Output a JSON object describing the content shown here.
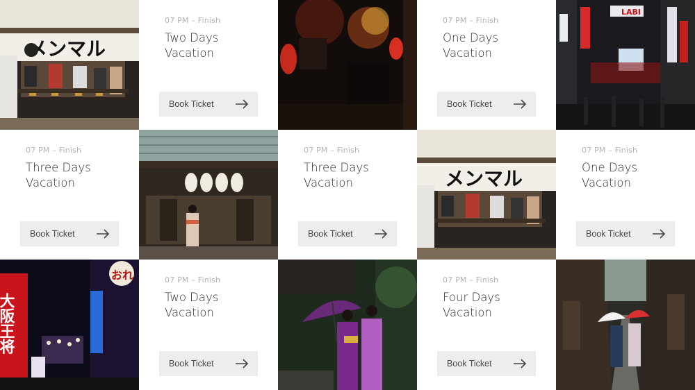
{
  "cards": [
    {
      "time": "07 PM – Finish",
      "title_line1": "Two Days",
      "title_line2": "Vacation",
      "button": "Book Ticket"
    },
    {
      "time": "07 PM – Finish",
      "title_line1": "One Days",
      "title_line2": "Vacation",
      "button": "Book Ticket"
    },
    {
      "time": "07 PM – Finish",
      "title_line1": "Three Days",
      "title_line2": "Vacation",
      "button": "Book Ticket"
    },
    {
      "time": "07 PM – Finish",
      "title_line1": "Three Days",
      "title_line2": "Vacation",
      "button": "Book Ticket"
    },
    {
      "time": "07 PM – Finish",
      "title_line1": "One Days",
      "title_line2": "Vacation",
      "button": "Book Ticket"
    },
    {
      "time": "07 PM – Finish",
      "title_line1": "Two Days",
      "title_line2": "Vacation",
      "button": "Book Ticket"
    },
    {
      "time": "07 PM – Finish",
      "title_line1": "Four Days",
      "title_line2": "Vacation",
      "button": "Book Ticket"
    }
  ],
  "photo_signs": {
    "ramen": "メンマル",
    "osaka_kanji": "大阪王将",
    "osaka_right": "おれ",
    "lab_sign": "LABI"
  },
  "icons": {
    "button_icon": "arrow-right-icon"
  },
  "colors": {
    "button_bg": "#ededed",
    "card_bg": "#ffffff",
    "muted_text": "#b3b3b3",
    "title_text": "#2b2b2b"
  }
}
